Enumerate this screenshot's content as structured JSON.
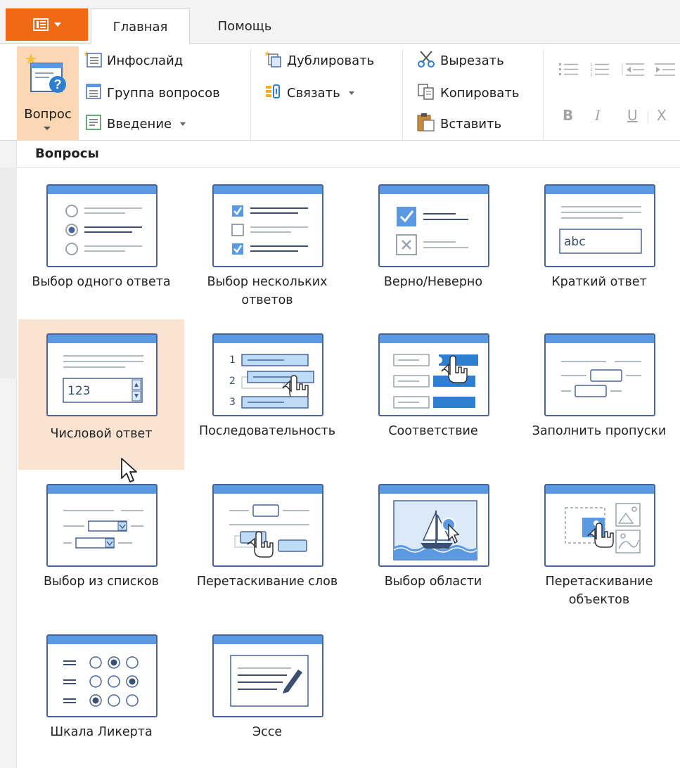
{
  "tabs": {
    "app_menu_icon": "list-layout-icon",
    "home": "Главная",
    "help": "Помощь"
  },
  "ribbon": {
    "question_button": "Вопрос",
    "infoslide": "Инфослайд",
    "question_group": "Группа вопросов",
    "intro": "Введение",
    "duplicate": "Дублировать",
    "link": "Связать",
    "cut": "Вырезать",
    "copy": "Копировать",
    "paste": "Вставить",
    "bold": "B",
    "italic": "I",
    "underline": "U",
    "subscript": "X"
  },
  "panel": {
    "header": "Вопросы",
    "items": [
      {
        "label": "Выбор одного ответа",
        "icon": "single-choice-icon"
      },
      {
        "label": "Выбор нескольких ответов",
        "icon": "multiple-choice-icon"
      },
      {
        "label": "Верно/Неверно",
        "icon": "true-false-icon"
      },
      {
        "label": "Краткий ответ",
        "icon": "short-answer-icon",
        "sample_text": "abc"
      },
      {
        "label": "Числовой ответ",
        "icon": "numeric-icon",
        "sample_text": "123"
      },
      {
        "label": "Последовательность",
        "icon": "sequence-icon",
        "row_numbers": [
          "1",
          "2",
          "3"
        ]
      },
      {
        "label": "Соответствие",
        "icon": "matching-icon"
      },
      {
        "label": "Заполнить пропуски",
        "icon": "fill-blanks-icon"
      },
      {
        "label": "Выбор из списков",
        "icon": "select-from-lists-icon"
      },
      {
        "label": "Перетаскивание слов",
        "icon": "drag-words-icon"
      },
      {
        "label": "Выбор области",
        "icon": "hotspot-icon"
      },
      {
        "label": "Перетаскивание объектов",
        "icon": "drag-objects-icon"
      },
      {
        "label": "Шкала Ликерта",
        "icon": "likert-scale-icon"
      },
      {
        "label": "Эссе",
        "icon": "essay-icon"
      }
    ]
  },
  "colors": {
    "accent": "#f06a16",
    "hover": "#fae3d1",
    "card_border": "#48659a",
    "card_bar": "#5b9ae3"
  }
}
